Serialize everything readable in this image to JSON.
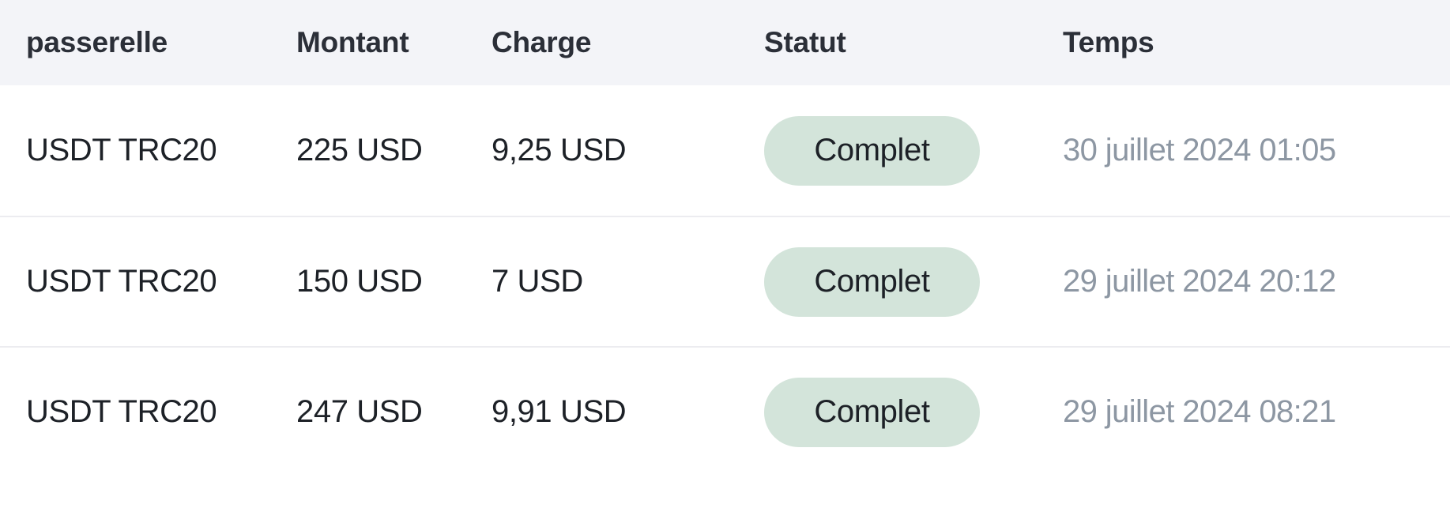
{
  "table": {
    "columns": [
      {
        "key": "gateway",
        "label": "passerelle"
      },
      {
        "key": "amount",
        "label": "Montant"
      },
      {
        "key": "charge",
        "label": "Charge"
      },
      {
        "key": "status",
        "label": "Statut"
      },
      {
        "key": "time",
        "label": "Temps"
      }
    ],
    "rows": [
      {
        "gateway": "USDT TRC20",
        "amount": "225 USD",
        "charge": "9,25 USD",
        "status": "Complet",
        "time": "30 juillet 2024 01:05"
      },
      {
        "gateway": "USDT TRC20",
        "amount": "150 USD",
        "charge": "7 USD",
        "status": "Complet",
        "time": "29 juillet 2024 20:12"
      },
      {
        "gateway": "USDT TRC20",
        "amount": "247 USD",
        "charge": "9,91 USD",
        "status": "Complet",
        "time": "29 juillet 2024 08:21"
      }
    ]
  },
  "colors": {
    "header_background": "#f3f4f8",
    "header_text": "#2b2f38",
    "row_background": "#ffffff",
    "row_text": "#1d2127",
    "row_divider": "#ececf0",
    "status_complete_background": "#d3e4da",
    "status_complete_text": "#1d2127",
    "timestamp_text": "#8d97a3"
  }
}
